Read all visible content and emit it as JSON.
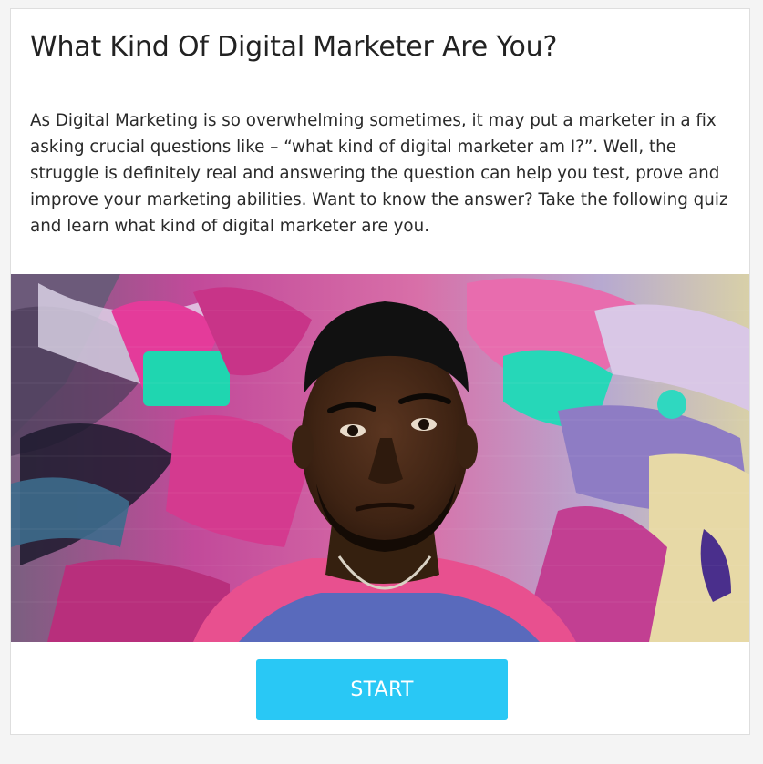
{
  "quiz": {
    "title": "What Kind Of Digital Marketer Are You?",
    "description": "As Digital Marketing is so overwhelming sometimes, it may put a marketer in a fix asking crucial questions like – “what kind of digital marketer am I?”. Well, the struggle is definitely real and answering the question can help you test, prove and improve your marketing abilities. Want to know the answer? Take the following quiz and learn what kind of digital marketer are you.",
    "start_label": "START"
  },
  "colors": {
    "button": "#29c8f5",
    "button_text": "#ffffff",
    "text": "#222222",
    "card_border": "#dedede"
  },
  "hero_image": {
    "depicts": "man-in-front-of-graffiti-wall"
  }
}
